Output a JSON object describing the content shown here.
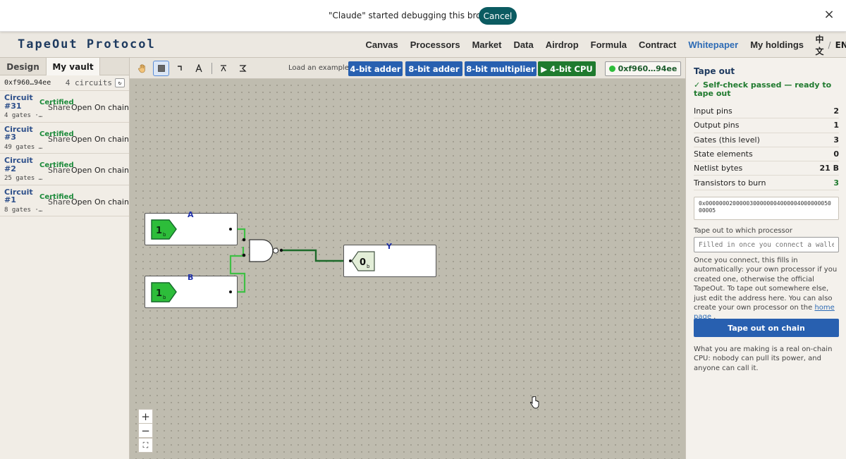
{
  "debug_bar": {
    "message": "\"Claude\" started debugging this browser",
    "cancel_label": "Cancel",
    "close_glyph": "×"
  },
  "header": {
    "brand": "TapeOut Protocol",
    "nav": [
      "Canvas",
      "Processors",
      "Market",
      "Data",
      "Airdrop",
      "Formula",
      "Contract",
      "Whitepaper",
      "My holdings"
    ],
    "active_nav": "Whitepaper",
    "lang_zh": "中文",
    "lang_sep": "/",
    "lang_en": "EN"
  },
  "sidebar": {
    "tabs": [
      "Design",
      "My vault"
    ],
    "active_tab": "My vault",
    "wallet": "0xf960…94ee",
    "circuit_count": "4 circuits",
    "refresh_glyph": "↻",
    "circuits": [
      {
        "name": "Circuit #31",
        "gates": "4 gates ·…",
        "status": "Certified",
        "share": "Share",
        "open": "Open",
        "chain": "On chain"
      },
      {
        "name": "Circuit #3",
        "gates": "49 gates …",
        "status": "Certified",
        "share": "Share",
        "open": "Open",
        "chain": "On chain"
      },
      {
        "name": "Circuit #2",
        "gates": "25 gates …",
        "status": "Certified",
        "share": "Share",
        "open": "Open",
        "chain": "On chain"
      },
      {
        "name": "Circuit #1",
        "gates": "8 gates ·…",
        "status": "Certified",
        "share": "Share",
        "open": "Open",
        "chain": "On chain"
      }
    ]
  },
  "toolbar": {
    "tools": [
      "hand-icon",
      "select-icon",
      "wire-icon",
      "text-icon",
      "top-icon",
      "sigma-icon"
    ],
    "active_tool": "select-icon",
    "load_label": "Load an example:",
    "examples": [
      "4-bit adder",
      "8-bit adder",
      "8-bit multiplier",
      "▶ 4-bit CPU"
    ],
    "wallet_label": "0xf960…94ee"
  },
  "canvas": {
    "input_a": {
      "label": "A",
      "value": "1",
      "sub": "b"
    },
    "input_b": {
      "label": "B",
      "value": "1",
      "sub": "b"
    },
    "output_y": {
      "label": "Y",
      "value": "0",
      "sub": "b"
    },
    "gate": "nand-gate",
    "zoom_in": "+",
    "zoom_out": "−",
    "fit": "⛶"
  },
  "panel": {
    "title": "Tape out",
    "pass_message": "✓ Self-check passed — ready to tape out",
    "stats": [
      {
        "label": "Input pins",
        "value": "2"
      },
      {
        "label": "Output pins",
        "value": "1"
      },
      {
        "label": "Gates (this level)",
        "value": "3"
      },
      {
        "label": "State elements",
        "value": "0"
      },
      {
        "label": "Netlist bytes",
        "value": "21 B"
      },
      {
        "label": "Transistors to burn",
        "value": "3"
      }
    ],
    "hex": "0x000000020000030000000400000400000005000005",
    "processor_label": "Tape out to which processor",
    "processor_placeholder": "Filled in once you connect a wallet…",
    "info_text": "Once you connect, this fills in automatically: your own processor if you created one, otherwise the official TapeOut. To tape out somewhere else, just edit the address here. You can also create your own processor on the",
    "info_link": "home page",
    "info_end": ".",
    "main_button": "Tape out on chain",
    "note": "What you are making is a real on-chain CPU: nobody can pull its power, and anyone can call it.",
    "colors": {
      "accent": "#2860b0",
      "success": "#1f7a2e",
      "wire_active": "#1d7a2e",
      "wire_idle": "#3fbf45"
    }
  }
}
